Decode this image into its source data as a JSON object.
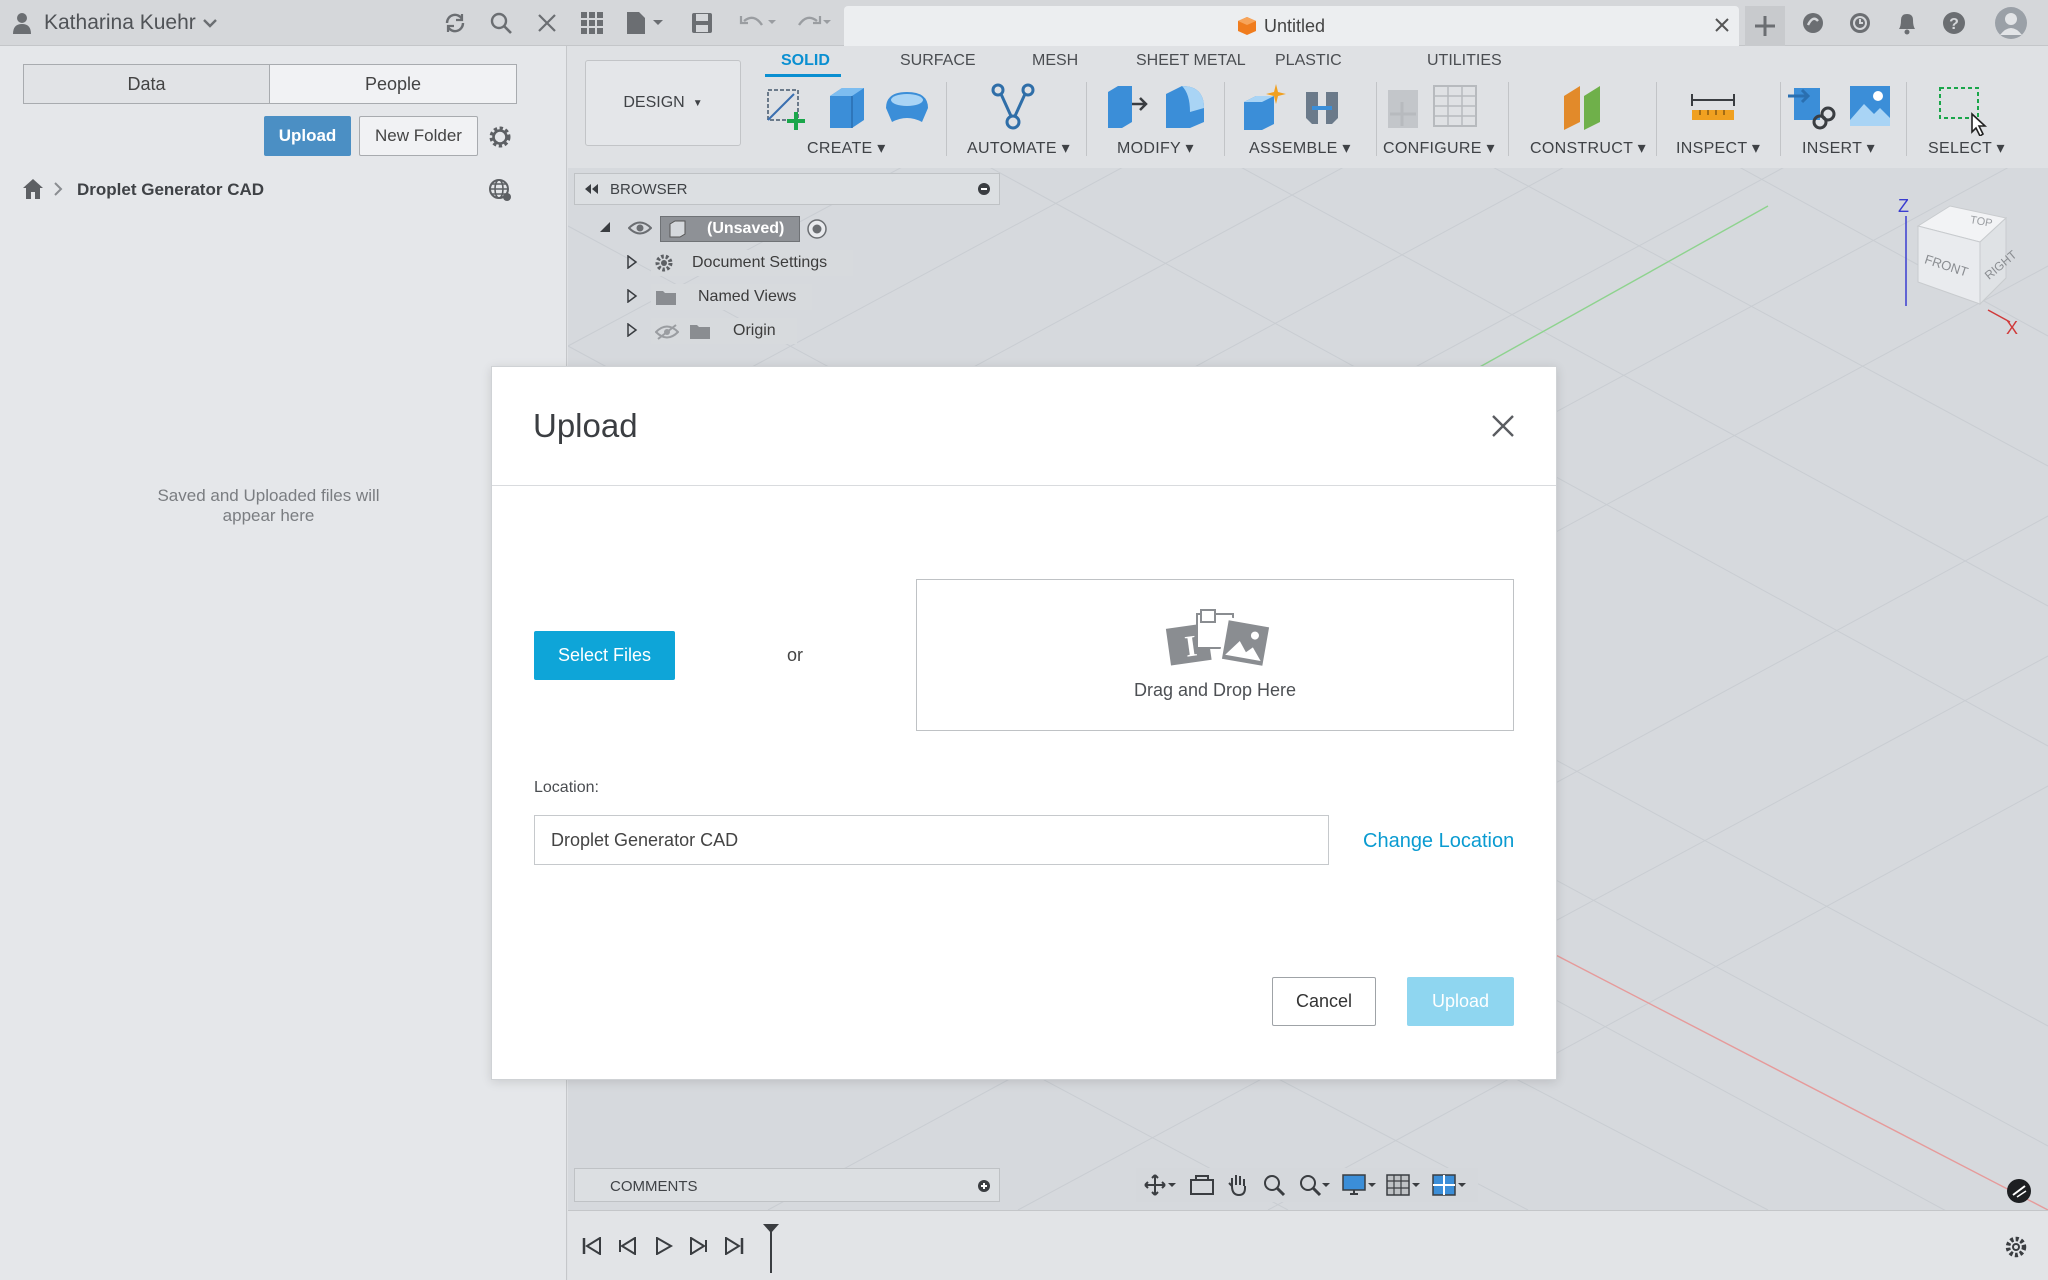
{
  "topbar": {
    "user_name": "Katharina Kuehr",
    "document_title": "Untitled"
  },
  "left_panel": {
    "tabs": [
      "Data",
      "People"
    ],
    "upload_label": "Upload",
    "new_folder_label": "New Folder",
    "breadcrumb": "Droplet Generator CAD",
    "empty_message_line1": "Saved and Uploaded files will",
    "empty_message_line2": "appear here"
  },
  "toolbar": {
    "workspace": "DESIGN",
    "tabs": [
      "SOLID",
      "SURFACE",
      "MESH",
      "SHEET METAL",
      "PLASTIC",
      "UTILITIES"
    ],
    "active_tab": "SOLID",
    "groups": [
      "CREATE",
      "AUTOMATE",
      "MODIFY",
      "ASSEMBLE",
      "CONFIGURE",
      "CONSTRUCT",
      "INSPECT",
      "INSERT",
      "SELECT"
    ]
  },
  "browser": {
    "title": "BROWSER",
    "root": "(Unsaved)",
    "items": [
      "Document Settings",
      "Named Views",
      "Origin"
    ]
  },
  "comments": {
    "title": "COMMENTS"
  },
  "viewcube": {
    "top": "TOP",
    "front": "FRONT",
    "right": "RIGHT",
    "axis_z": "Z",
    "axis_x": "X"
  },
  "dialog": {
    "title": "Upload",
    "select_files_label": "Select Files",
    "or_text": "or",
    "drop_text": "Drag and Drop Here",
    "location_label": "Location:",
    "location_value": "Droplet Generator CAD",
    "change_location_label": "Change Location",
    "cancel_label": "Cancel",
    "upload_label": "Upload"
  },
  "colors": {
    "accent": "#0ea5d8",
    "upload_disabled": "#8fd6f0",
    "link": "#0a9bd1"
  }
}
